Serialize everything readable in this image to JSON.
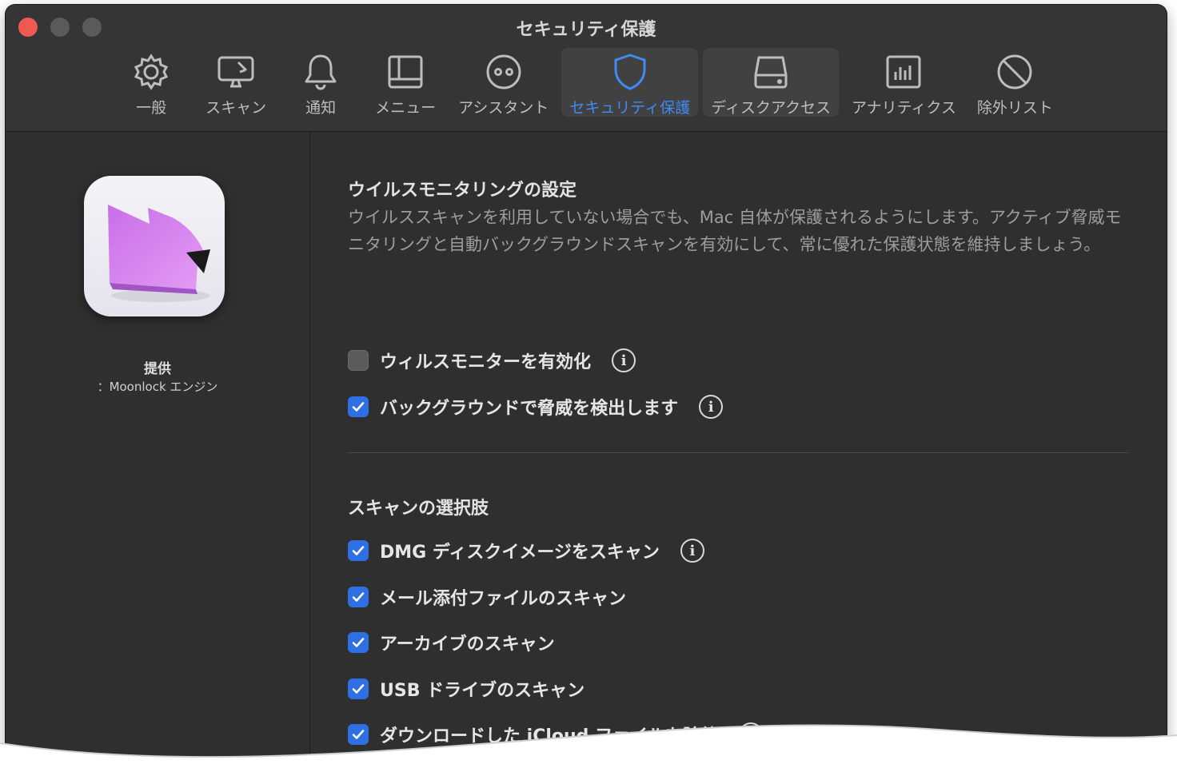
{
  "window": {
    "title": "セキュリティ保護"
  },
  "toolbar": {
    "items": [
      {
        "label": "一般",
        "icon": "gear-icon"
      },
      {
        "label": "スキャン",
        "icon": "monitor-scan-icon"
      },
      {
        "label": "通知",
        "icon": "bell-icon"
      },
      {
        "label": "メニュー",
        "icon": "menu-window-icon"
      },
      {
        "label": "アシスタント",
        "icon": "assistant-face-icon"
      },
      {
        "label": "セキュリティ保護",
        "icon": "shield-icon",
        "active": true
      },
      {
        "label": "ディスクアクセス",
        "icon": "disk-drive-icon"
      },
      {
        "label": "アナリティクス",
        "icon": "analytics-chart-icon"
      },
      {
        "label": "除外リスト",
        "icon": "prohibited-icon"
      }
    ],
    "accent_color": "#3d8cf5"
  },
  "sidebar": {
    "provider_label": "提供",
    "provider_name": "：Moonlock エンジン",
    "app_icon": "moonlock-app-icon"
  },
  "main": {
    "monitoring": {
      "title": "ウイルスモニタリングの設定",
      "description": "ウイルススキャンを利用していない場合でも、Mac 自体が保護されるようにします。アクティブ脅威モニタリングと自動バックグラウンドスキャンを有効にして、常に優れた保護状態を維持しましょう。",
      "options": [
        {
          "label": "ウィルスモニターを有効化",
          "checked": false,
          "info": true
        },
        {
          "label": "バックグラウンドで脅威を検出します",
          "checked": true,
          "info": true
        }
      ]
    },
    "scan_options": {
      "title": "スキャンの選択肢",
      "options": [
        {
          "label": "DMG ディスクイメージをスキャン",
          "checked": true,
          "info": true
        },
        {
          "label": "メール添付ファイルのスキャン",
          "checked": true,
          "info": false
        },
        {
          "label": "アーカイブのスキャン",
          "checked": true,
          "info": false
        },
        {
          "label": "USB ドライブのスキャン",
          "checked": true,
          "info": false
        },
        {
          "label": "ダウンロードした iCloud ファイルを除外",
          "checked": true,
          "info": true
        }
      ]
    },
    "checkbox_color": "#2f6fe4"
  }
}
